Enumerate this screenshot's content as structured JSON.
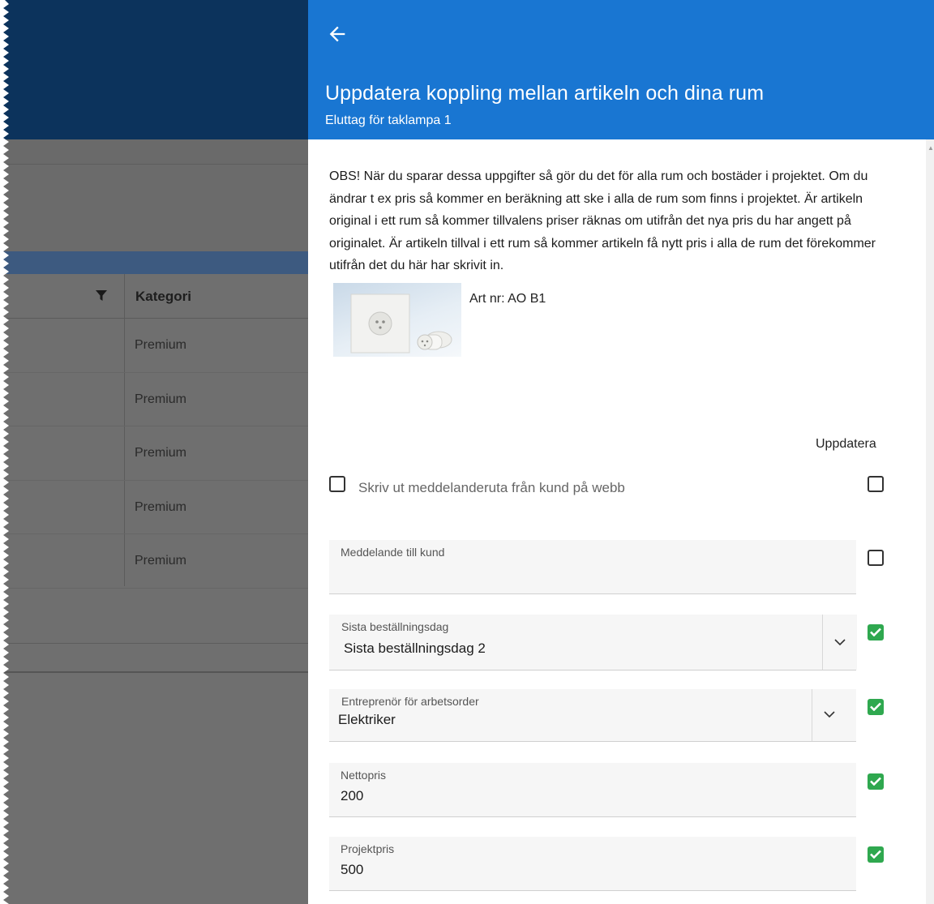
{
  "background": {
    "column_header": "Kategori",
    "rows": [
      "Premium",
      "Premium",
      "Premium",
      "Premium",
      "Premium"
    ]
  },
  "drawer": {
    "back_icon": "arrow-left-icon",
    "title": "Uppdatera koppling mellan artikeln och dina rum",
    "subtitle": "Eluttag för taklampa 1",
    "warning": "OBS! När du sparar dessa uppgifter så gör du det för alla rum och bostäder i projektet. Om du ändrar t ex pris så kommer en beräkning att ske i alla de rum som finns i projektet. Är artikeln original i ett rum så kommer tillvalens priser räknas om utifrån det nya pris du har angett på originalet. Är artikeln tillval i ett rum så kommer artikeln få nytt pris i alla de rum det förekommer utifrån det du här har skrivit in.",
    "article_number": "Art nr: AO B1",
    "update_column_header": "Uppdatera",
    "print_message_label": "Skriv ut meddelanderuta från kund på webb",
    "fields": {
      "message": {
        "label": "Meddelande till kund",
        "value": ""
      },
      "last_order_day": {
        "label": "Sista beställningsdag",
        "value": "Sista beställningsdag 2"
      },
      "contractor": {
        "label": "Entreprenör för arbetsorder",
        "value": "Elektriker"
      },
      "net_price": {
        "label": "Nettopris",
        "value": "200"
      },
      "project_price": {
        "label": "Projektpris",
        "value": "500"
      }
    },
    "update_checks": {
      "print_message": false,
      "message": false,
      "last_order_day": true,
      "contractor": true,
      "net_price": true,
      "project_price": true
    },
    "colors": {
      "header": "#1976d2",
      "checked": "#2fa84f",
      "overlay": "#6f6f6f",
      "appbar": "#0c335c"
    }
  }
}
